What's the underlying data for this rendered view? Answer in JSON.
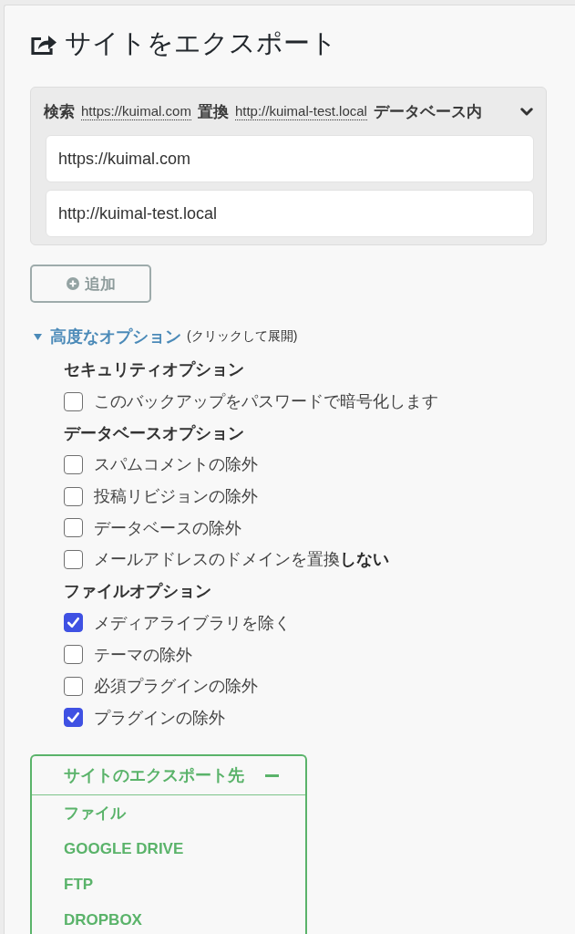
{
  "title": {
    "text": "サイトをエクスポート"
  },
  "search_replace": {
    "expanded": true,
    "header": [
      {
        "kind": "label",
        "text": "検索"
      },
      {
        "kind": "value",
        "text": "https://kuimal.com"
      },
      {
        "kind": "label",
        "text": "置換"
      },
      {
        "kind": "value",
        "text": "http://kuimal-test.local"
      },
      {
        "kind": "label",
        "text": "データベース内"
      }
    ],
    "fields": [
      {
        "value": "https://kuimal.com"
      },
      {
        "value": "http://kuimal-test.local"
      }
    ]
  },
  "add_button": {
    "label": "追加"
  },
  "advanced_options": {
    "label": "高度なオプション",
    "hint": "(クリックして展開)",
    "expanded": true,
    "sections": [
      {
        "heading": "セキュリティオプション",
        "options": [
          {
            "label": "このバックアップをパスワードで暗号化します",
            "checked": false
          }
        ]
      },
      {
        "heading": "データベースオプション",
        "options": [
          {
            "label": "スパムコメントの除外",
            "checked": false
          },
          {
            "label": "投稿リビジョンの除外",
            "checked": false
          },
          {
            "label": "データベースの除外",
            "checked": false
          },
          {
            "label": "メールアドレスのドメインを置換**しない**",
            "checked": false
          }
        ]
      },
      {
        "heading": "ファイルオプション",
        "options": [
          {
            "label": "メディアライブラリを除く",
            "checked": true
          },
          {
            "label": "テーマの除外",
            "checked": false
          },
          {
            "label": "必須プラグインの除外",
            "checked": false
          },
          {
            "label": "プラグインの除外",
            "checked": true
          }
        ]
      }
    ]
  },
  "export_to": {
    "title": "サイトのエクスポート先",
    "expanded": true,
    "items": [
      "ファイル",
      "GOOGLE DRIVE",
      "FTP",
      "DROPBOX"
    ]
  }
}
